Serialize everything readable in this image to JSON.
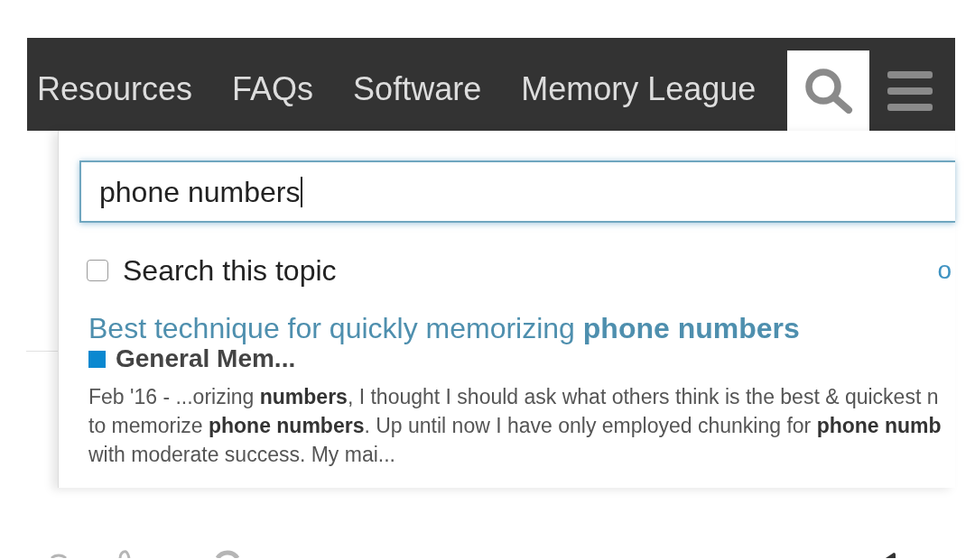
{
  "header": {
    "nav_links": [
      {
        "label": "Resources"
      },
      {
        "label": "FAQs"
      },
      {
        "label": "Software"
      },
      {
        "label": "Memory League"
      }
    ]
  },
  "search": {
    "expanded": true,
    "query": "phone numbers",
    "search_this_topic": {
      "label": "Search this topic",
      "checked": false
    },
    "options_link": "o",
    "results": [
      {
        "title": "Best technique for quickly memorizing **phone numbers**",
        "category": {
          "name": "General Mem...",
          "color": "#0a88d0"
        },
        "blurb": [
          "Feb '16 - ...orizing **numbers**, I thought I should ask what others think is the best & quickest n",
          "to memorize **phone numbers**. Up until now I have only employed chunking for **phone numb**",
          "with moderate success. My mai..."
        ]
      }
    ]
  }
}
